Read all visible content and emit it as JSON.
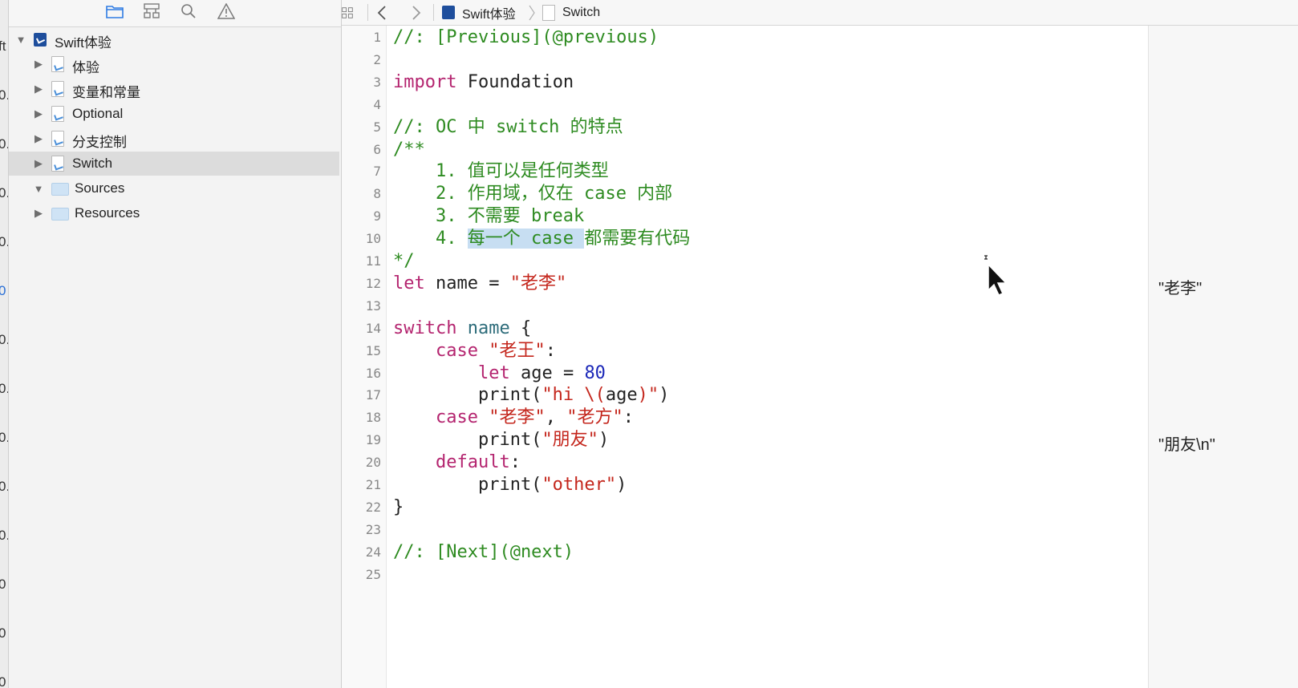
{
  "left_strip": {
    "glyphs": [
      "ft",
      "0.",
      "0.",
      "0.",
      "0.",
      "0",
      "0.",
      "0.",
      "0.",
      "0.",
      "0.",
      "0",
      "0",
      "0"
    ]
  },
  "navigator": {
    "toolbar_icons": [
      "folder-icon",
      "hierarchy-icon",
      "search-icon",
      "warning-icon"
    ],
    "items": [
      {
        "label": "Swift体验",
        "icon": "project-icon",
        "expanded": true,
        "level": 0
      },
      {
        "label": "体验",
        "icon": "playground-page-icon",
        "expanded": false,
        "level": 1
      },
      {
        "label": "变量和常量",
        "icon": "playground-page-icon",
        "expanded": false,
        "level": 1
      },
      {
        "label": "Optional",
        "icon": "playground-page-icon",
        "expanded": false,
        "level": 1
      },
      {
        "label": "分支控制",
        "icon": "playground-page-icon",
        "expanded": false,
        "level": 1
      },
      {
        "label": "Switch",
        "icon": "playground-page-icon",
        "expanded": false,
        "level": 1,
        "selected": true
      },
      {
        "label": "Sources",
        "icon": "folder-icon",
        "expanded": true,
        "level": 1
      },
      {
        "label": "Resources",
        "icon": "folder-icon",
        "expanded": false,
        "level": 1
      }
    ]
  },
  "jump_bar": {
    "icons": [
      "grid-icon",
      "back-arrow-icon",
      "forward-arrow-icon"
    ],
    "crumbs": [
      {
        "label": "Swift体验",
        "icon": "project-icon"
      },
      {
        "label": "Switch",
        "icon": "playground-page-icon"
      }
    ]
  },
  "code_lines": [
    {
      "n": "1",
      "tokens": [
        {
          "t": "//: [Previous](@previous)",
          "c": "cm"
        }
      ]
    },
    {
      "n": "2",
      "tokens": []
    },
    {
      "n": "3",
      "tokens": [
        {
          "t": "import",
          "c": "kw"
        },
        {
          "t": " Foundation",
          "c": ""
        }
      ]
    },
    {
      "n": "4",
      "tokens": []
    },
    {
      "n": "5",
      "tokens": [
        {
          "t": "//: OC 中 switch 的特点",
          "c": "cm"
        }
      ]
    },
    {
      "n": "6",
      "tokens": [
        {
          "t": "/**",
          "c": "cm"
        }
      ]
    },
    {
      "n": "7",
      "tokens": [
        {
          "t": "    1. 值可以是任何类型",
          "c": "cm"
        }
      ]
    },
    {
      "n": "8",
      "tokens": [
        {
          "t": "    2. 作用域，仅在 case 内部",
          "c": "cm"
        }
      ]
    },
    {
      "n": "9",
      "tokens": [
        {
          "t": "    3. 不需要 break",
          "c": "cm"
        }
      ]
    },
    {
      "n": "10",
      "tokens": [
        {
          "t": "    4. ",
          "c": "cm"
        },
        {
          "t": "每一个 case ",
          "c": "cm hl"
        },
        {
          "t": "都需要有代码",
          "c": "cm"
        }
      ]
    },
    {
      "n": "11",
      "tokens": [
        {
          "t": "*/",
          "c": "cm"
        }
      ]
    },
    {
      "n": "12",
      "tokens": [
        {
          "t": "let",
          "c": "kw"
        },
        {
          "t": " name = ",
          "c": ""
        },
        {
          "t": "\"老李\"",
          "c": "str"
        }
      ]
    },
    {
      "n": "13",
      "tokens": []
    },
    {
      "n": "14",
      "tokens": [
        {
          "t": "switch",
          "c": "kw"
        },
        {
          "t": " ",
          "c": ""
        },
        {
          "t": "name",
          "c": "ident"
        },
        {
          "t": " {",
          "c": ""
        }
      ]
    },
    {
      "n": "15",
      "tokens": [
        {
          "t": "    ",
          "c": ""
        },
        {
          "t": "case",
          "c": "kw"
        },
        {
          "t": " ",
          "c": ""
        },
        {
          "t": "\"老王\"",
          "c": "str"
        },
        {
          "t": ":",
          "c": ""
        }
      ]
    },
    {
      "n": "16",
      "tokens": [
        {
          "t": "        ",
          "c": ""
        },
        {
          "t": "let",
          "c": "kw"
        },
        {
          "t": " age = ",
          "c": ""
        },
        {
          "t": "80",
          "c": "num"
        }
      ]
    },
    {
      "n": "17",
      "tokens": [
        {
          "t": "        print(",
          "c": ""
        },
        {
          "t": "\"hi \\(",
          "c": "str"
        },
        {
          "t": "age",
          "c": ""
        },
        {
          "t": ")\"",
          "c": "str"
        },
        {
          "t": ")",
          "c": ""
        }
      ]
    },
    {
      "n": "18",
      "tokens": [
        {
          "t": "    ",
          "c": ""
        },
        {
          "t": "case",
          "c": "kw"
        },
        {
          "t": " ",
          "c": ""
        },
        {
          "t": "\"老李\"",
          "c": "str"
        },
        {
          "t": ", ",
          "c": ""
        },
        {
          "t": "\"老方\"",
          "c": "str"
        },
        {
          "t": ":",
          "c": ""
        }
      ]
    },
    {
      "n": "19",
      "tokens": [
        {
          "t": "        print(",
          "c": ""
        },
        {
          "t": "\"朋友\"",
          "c": "str"
        },
        {
          "t": ")",
          "c": ""
        }
      ]
    },
    {
      "n": "20",
      "tokens": [
        {
          "t": "    ",
          "c": ""
        },
        {
          "t": "default",
          "c": "kw"
        },
        {
          "t": ":",
          "c": ""
        }
      ]
    },
    {
      "n": "21",
      "tokens": [
        {
          "t": "        print(",
          "c": ""
        },
        {
          "t": "\"other\"",
          "c": "str"
        },
        {
          "t": ")",
          "c": ""
        }
      ]
    },
    {
      "n": "22",
      "tokens": [
        {
          "t": "}",
          "c": ""
        }
      ]
    },
    {
      "n": "23",
      "tokens": []
    },
    {
      "n": "24",
      "tokens": [
        {
          "t": "//: [Next](@next)",
          "c": "cm"
        }
      ]
    },
    {
      "n": "25",
      "tokens": []
    }
  ],
  "results": [
    {
      "line": "12",
      "text": "\"老李\""
    },
    {
      "line": "19",
      "text": "\"朋友\\n\""
    }
  ],
  "colors": {
    "comment": "#2e8b21",
    "keyword": "#b4246f",
    "string": "#c4261c",
    "number": "#1b27b8",
    "identifier": "#2d6c7a",
    "selection": "#c7def2",
    "sidebar_selected": "#dcdcdc"
  }
}
